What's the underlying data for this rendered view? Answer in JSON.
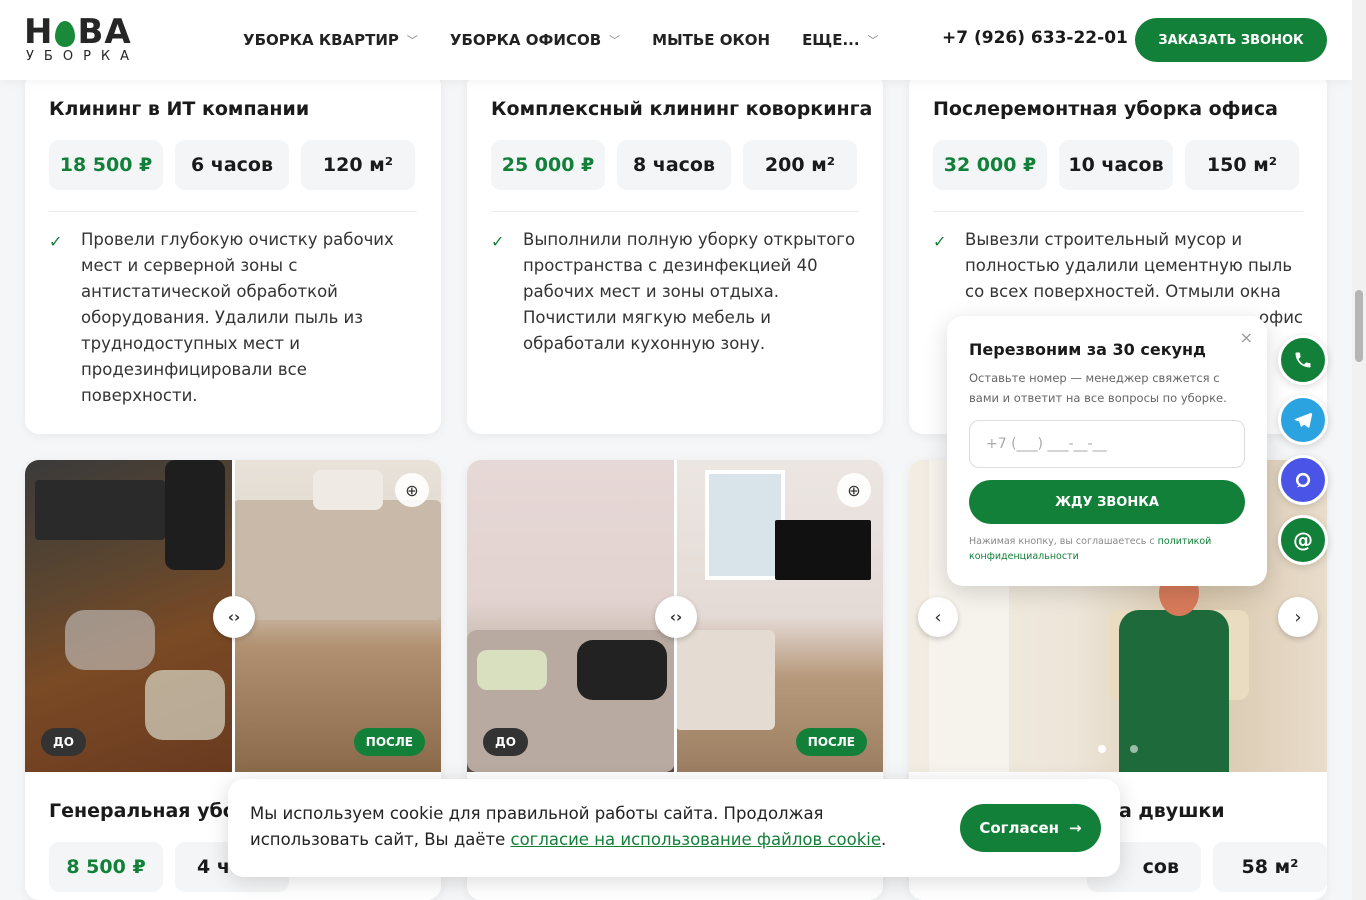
{
  "header": {
    "logo_text_1": "Н",
    "logo_text_2": "ВА",
    "logo_sub": "УБОРКА",
    "nav": [
      {
        "label": "УБОРКА КВАРТИР",
        "dropdown": true
      },
      {
        "label": "УБОРКА ОФИСОВ",
        "dropdown": true
      },
      {
        "label": "МЫТЬЕ ОКОН",
        "dropdown": false
      },
      {
        "label": "ЕЩЕ...",
        "dropdown": true
      }
    ],
    "phone": "+7 (926) 633-22-01",
    "cta": "ЗАКАЗАТЬ ЗВОНОК"
  },
  "cases_top": [
    {
      "title": "Клининг в ИТ компании",
      "price": "18 500 ₽",
      "duration": "6 часов",
      "area": "120 м²",
      "description": "Провели глубокую очистку рабочих мест и серверной зоны с антистатической обработкой оборудования. Удалили пыль из труднодоступных мест и продезинфицировали все поверхности."
    },
    {
      "title": "Комплексный клининг коворкинга",
      "price": "25 000 ₽",
      "duration": "8 часов",
      "area": "200 м²",
      "description": "Выполнили полную уборку открытого пространства с дезинфекцией 40 рабочих мест и зоны отдыха. Почистили мягкую мебель и обработали кухонную зону."
    },
    {
      "title": "Послеремонтная уборка офиса",
      "price": "32 000 ₽",
      "duration": "10 часов",
      "area": "150 м²",
      "description": "Вывезли строительный мусор и полностью удалили цементную пыль со всех поверхностей. Отмыли окна",
      "description_tail": "офис"
    }
  ],
  "photo_labels": {
    "before": "ДО",
    "after": "ПОСЛЕ"
  },
  "cases_bottom": [
    {
      "title_visible": "Генеральная убор",
      "price": "8 500 ₽",
      "duration_visible": "4 ч"
    },
    {
      "title_visible": "а двушки",
      "duration_visible": "сов",
      "area": "58 м²"
    }
  ],
  "callback_popup": {
    "close": "×",
    "title": "Перезвоним за 30 секунд",
    "text": "Оставьте номер — менеджер свяжется с вами и ответит на все вопросы по уборке.",
    "phone_placeholder": "+7 (___) ___-__-__",
    "button": "ЖДУ ЗВОНКА",
    "legal_prefix": "Нажимая кнопку, вы соглашаетесь с ",
    "legal_link": "политикой конфиденциальности"
  },
  "social": [
    {
      "name": "phone-icon",
      "color": "#13803a"
    },
    {
      "name": "telegram-icon",
      "color": "#2aa3e0"
    },
    {
      "name": "max-messenger-icon",
      "color": "#4a55e8"
    },
    {
      "name": "email-icon",
      "color": "#13803a"
    }
  ],
  "cookie": {
    "text": "Мы используем cookie для правильной работы сайта. Продолжая использовать сайт, Вы даёте ",
    "link": "согласие на использование файлов cookie",
    "suffix": ".",
    "button": "Согласен"
  },
  "colors": {
    "brand": "#13803a",
    "text": "#1a1a1a"
  }
}
